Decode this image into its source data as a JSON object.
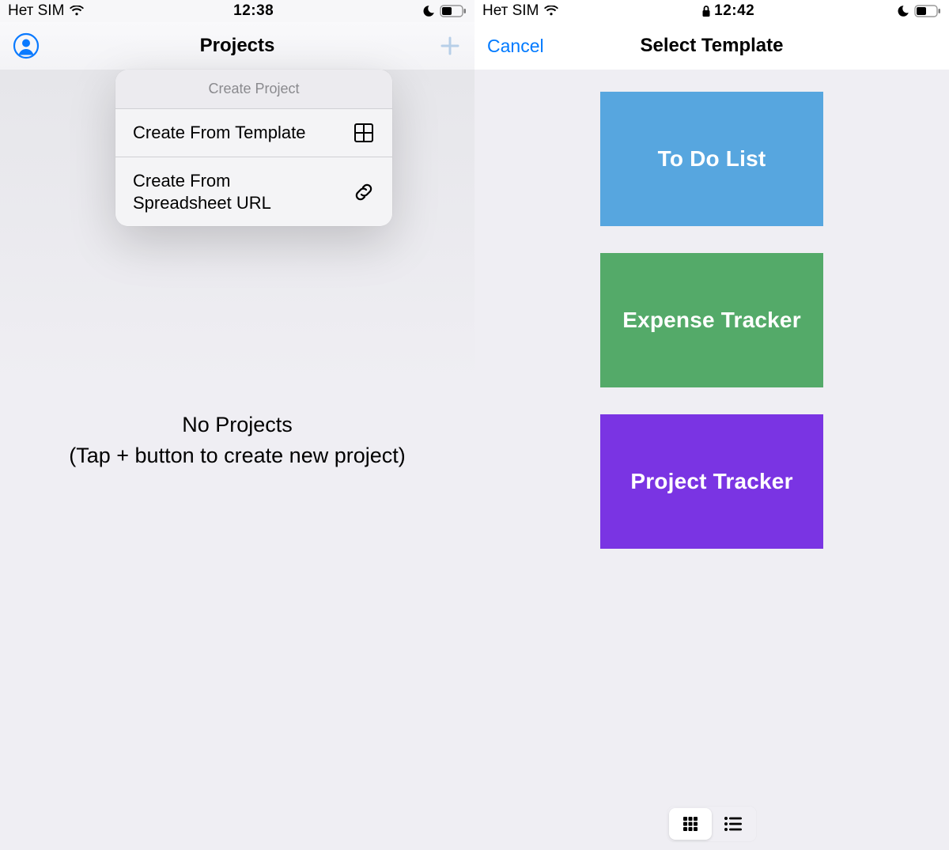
{
  "left": {
    "status": {
      "sim": "Нет SIM",
      "time": "12:38"
    },
    "nav": {
      "title": "Projects"
    },
    "popover": {
      "header": "Create Project",
      "items": [
        {
          "label": "Create From Template",
          "icon": "grid-icon"
        },
        {
          "label": "Create From Spreadsheet URL",
          "icon": "link-icon"
        }
      ]
    },
    "empty": {
      "line1": "No Projects",
      "line2": "(Tap + button to create new project)"
    }
  },
  "right": {
    "status": {
      "sim": "Нет SIM",
      "time": "12:42"
    },
    "nav": {
      "cancel_label": "Cancel",
      "title": "Select Template"
    },
    "templates": [
      {
        "label": "To Do List",
        "color": "#57a6df"
      },
      {
        "label": "Expense Tracker",
        "color": "#54aa69"
      },
      {
        "label": "Project Tracker",
        "color": "#7a34e3"
      }
    ],
    "segmented": {
      "active": "grid"
    }
  }
}
